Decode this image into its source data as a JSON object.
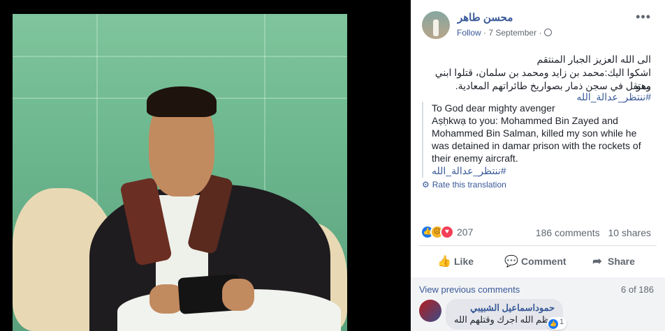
{
  "post": {
    "author": "محسن طاهر",
    "follow_label": "Follow",
    "separator": "·",
    "date": "7 September",
    "more_label": "•••",
    "arabic_lines": [
      "الى الله العزيز الجبار المنتقم",
      "اشكوا اليك:محمد بن زايد ومحمد بن سلمان، قتلوا ابني وهو",
      "معتقل في سجن ذمار بصواريخ طائراتهم المعادية."
    ],
    "hashtag": "#ننتظر_عدالة_الله",
    "translation_lines": [
      "To God dear mighty avenger",
      "Aṣḥkwạ to you: Mohammed Bin Zayed and",
      "Mohammed Bin Salman, killed my son while he",
      "was detained in damar prison with the rockets of",
      "their enemy aircraft."
    ],
    "translation_hashtag": "#ننتظر_عدالة_الله",
    "rate_translation": "Rate this translation"
  },
  "stats": {
    "reaction_count": "207",
    "comments": "186 comments",
    "shares": "10 shares"
  },
  "actions": {
    "like": "Like",
    "comment": "Comment",
    "share": "Share"
  },
  "comments": {
    "view_previous": "View previous comments",
    "pager": "6 of 186",
    "items": [
      {
        "name": "حموداسماعيل الشبيبي",
        "text": "عظم الله اجرك وقتلهم الله",
        "reaction_count": "1"
      }
    ]
  },
  "colors": {
    "link": "#385898",
    "like_blue": "#1877f2",
    "love_red": "#f33e58",
    "sad_yellow": "#f7b125"
  },
  "icons": [
    "globe-icon",
    "more-icon",
    "gear-icon",
    "like-icon",
    "comment-icon",
    "share-icon"
  ]
}
